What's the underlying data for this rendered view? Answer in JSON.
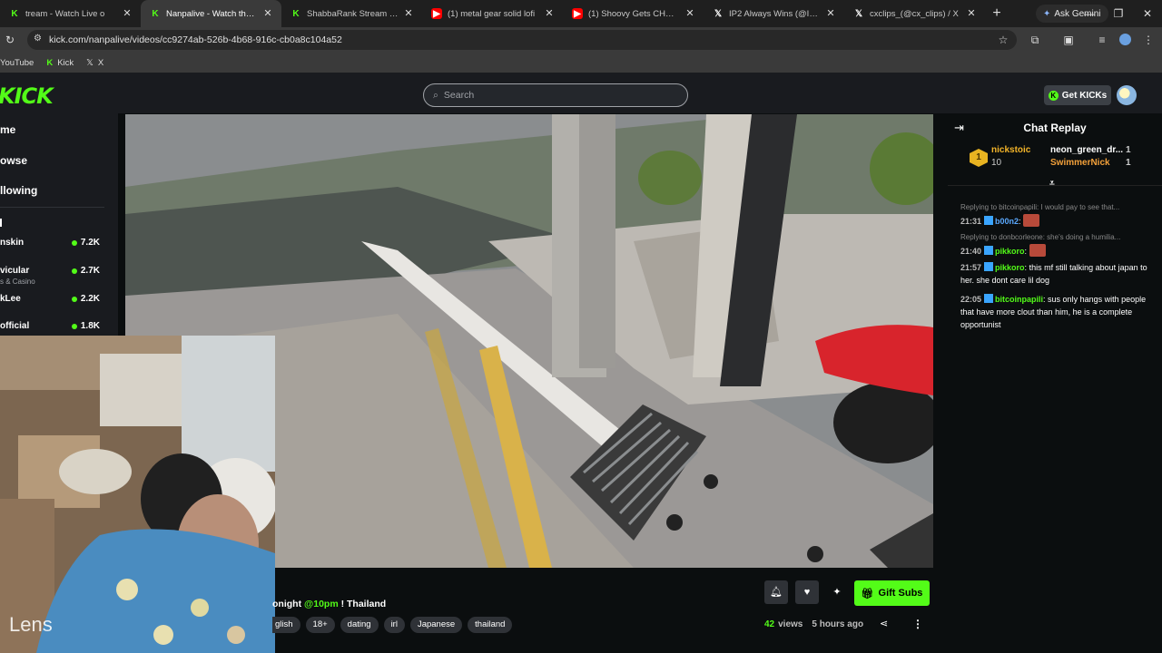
{
  "browser": {
    "tabs": [
      {
        "title": "tream - Watch Live o",
        "favicon": "kick",
        "active": false
      },
      {
        "title": "Nanpalive - Watch the V",
        "favicon": "kick",
        "active": true
      },
      {
        "title": "ShabbaRank Stream - Watch",
        "favicon": "kick",
        "active": false
      },
      {
        "title": "(1) metal gear solid lofi",
        "favicon": "youtube",
        "active": false
      },
      {
        "title": "(1) Shoovy Gets CHOKED O",
        "favicon": "youtube",
        "active": false
      },
      {
        "title": "IP2 Always Wins (@Ip2Alwa",
        "favicon": "x",
        "active": false
      },
      {
        "title": "cxclips_(@cx_clips) / X",
        "favicon": "x",
        "active": false
      }
    ],
    "gemini_label": "Ask Gemini",
    "url": "kick.com/nanpalive/videos/cc9274ab-526b-4b68-916c-cb0a8c104a52",
    "bookmarks": [
      {
        "label": "YouTube"
      },
      {
        "label": "Kick"
      },
      {
        "label": "X"
      }
    ]
  },
  "kick": {
    "logo": "KICK",
    "search_placeholder": "Search",
    "get_kicks_label": "Get KICKs",
    "nav": {
      "home": "me",
      "browse": "owse",
      "following": "llowing"
    },
    "recommended": [
      {
        "name": "nskin",
        "sub": "",
        "viewers": "7.2K"
      },
      {
        "name": "vicular",
        "sub": "s & Casino",
        "viewers": "2.7K"
      },
      {
        "name": "kLee",
        "sub": "",
        "viewers": "2.2K"
      },
      {
        "name": "official",
        "sub": "",
        "viewers": "1.8K"
      }
    ],
    "video": {
      "title_prefix": "onight ",
      "title_highlight": "@10pm",
      "title_suffix": " ! Thailand",
      "tags": [
        "glish",
        "18+",
        "dating",
        "irl",
        "Japanese",
        "thailand"
      ],
      "views": "42",
      "views_label": "views",
      "age": "5 hours ago",
      "gift_subs_label": "Gift Subs"
    },
    "webcam_watermark": "Lens",
    "chat": {
      "title": "Chat Replay",
      "leaderboard": {
        "rank": "1",
        "top_user": "nickstoic",
        "top_count": "10",
        "users": [
          {
            "name": "neon_green_dr...",
            "count": "1"
          },
          {
            "name": "SwimmerNick",
            "count": "1"
          }
        ]
      },
      "messages": [
        {
          "reply": "Replying to bitcoinpapili: I would pay to see that...",
          "time": "21:31",
          "user": "b00n2",
          "text": ""
        },
        {
          "reply": "Replying to donbcorleone: she's doing a humilia...",
          "time": "21:40",
          "user": "pikkoro",
          "text": ""
        },
        {
          "reply": "",
          "time": "21:57",
          "user": "pikkoro",
          "text": "this mf still talking about japan to her. she dont care lil dog"
        },
        {
          "reply": "",
          "time": "22:05",
          "user": "bitcoinpapili",
          "text": "sus only hangs with people that have more clout than him, he is a complete opportunist"
        }
      ]
    }
  },
  "colors": {
    "accent": "#53fc18",
    "bg": "#0b0e0f",
    "panel": "#191b1f"
  }
}
